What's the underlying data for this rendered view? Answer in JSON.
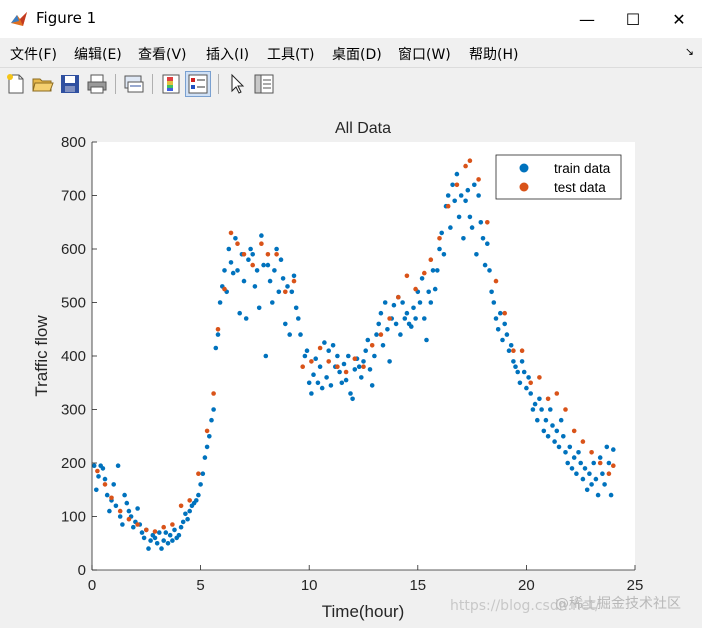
{
  "window": {
    "title": "Figure 1",
    "controls": {
      "minimize": "—",
      "maximize": "☐",
      "close": "✕"
    }
  },
  "menu": {
    "items": [
      "文件(F)",
      "编辑(E)",
      "查看(V)",
      "插入(I)",
      "工具(T)",
      "桌面(D)",
      "窗口(W)",
      "帮助(H)"
    ],
    "overflow_icon": "arrow-corner-icon"
  },
  "toolbar": {
    "buttons": [
      "new-figure-icon",
      "open-file-icon",
      "save-icon",
      "print-icon",
      "link-plot-icon",
      "colorbar-icon",
      "legend-icon",
      "pointer-icon",
      "property-editor-icon"
    ]
  },
  "chart_data": {
    "type": "scatter",
    "title": "All Data",
    "xlabel": "Time(hour)",
    "ylabel": "Traffic flow",
    "xlim": [
      0,
      25
    ],
    "ylim": [
      0,
      800
    ],
    "xticks": [
      0,
      5,
      10,
      15,
      20,
      25
    ],
    "yticks": [
      0,
      100,
      200,
      300,
      400,
      500,
      600,
      700,
      800
    ],
    "grid": false,
    "legend_position": "top-right",
    "series": [
      {
        "name": "train data",
        "color": "#0072BD",
        "points": [
          [
            0.1,
            195
          ],
          [
            0.2,
            150
          ],
          [
            0.3,
            175
          ],
          [
            0.4,
            195
          ],
          [
            0.5,
            190
          ],
          [
            0.6,
            170
          ],
          [
            0.7,
            140
          ],
          [
            0.8,
            110
          ],
          [
            0.9,
            130
          ],
          [
            1.0,
            160
          ],
          [
            1.1,
            120
          ],
          [
            1.2,
            195
          ],
          [
            1.3,
            100
          ],
          [
            1.4,
            85
          ],
          [
            1.5,
            140
          ],
          [
            1.6,
            125
          ],
          [
            1.7,
            110
          ],
          [
            1.8,
            100
          ],
          [
            1.9,
            80
          ],
          [
            2.0,
            90
          ],
          [
            2.1,
            115
          ],
          [
            2.2,
            85
          ],
          [
            2.3,
            70
          ],
          [
            2.4,
            60
          ],
          [
            2.5,
            75
          ],
          [
            2.6,
            40
          ],
          [
            2.7,
            55
          ],
          [
            2.8,
            65
          ],
          [
            2.9,
            60
          ],
          [
            3.0,
            50
          ],
          [
            3.1,
            70
          ],
          [
            3.2,
            40
          ],
          [
            3.3,
            55
          ],
          [
            3.4,
            70
          ],
          [
            3.5,
            50
          ],
          [
            3.6,
            65
          ],
          [
            3.7,
            55
          ],
          [
            3.8,
            75
          ],
          [
            3.9,
            60
          ],
          [
            4.0,
            65
          ],
          [
            4.1,
            80
          ],
          [
            4.2,
            90
          ],
          [
            4.3,
            105
          ],
          [
            4.4,
            95
          ],
          [
            4.5,
            110
          ],
          [
            4.6,
            120
          ],
          [
            4.7,
            125
          ],
          [
            4.8,
            130
          ],
          [
            4.9,
            140
          ],
          [
            5.0,
            160
          ],
          [
            5.1,
            180
          ],
          [
            5.2,
            210
          ],
          [
            5.3,
            230
          ],
          [
            5.4,
            250
          ],
          [
            5.5,
            280
          ],
          [
            5.6,
            300
          ],
          [
            5.7,
            415
          ],
          [
            5.8,
            440
          ],
          [
            5.9,
            500
          ],
          [
            6.0,
            530
          ],
          [
            6.1,
            560
          ],
          [
            6.2,
            520
          ],
          [
            6.3,
            600
          ],
          [
            6.4,
            575
          ],
          [
            6.5,
            555
          ],
          [
            6.6,
            620
          ],
          [
            6.7,
            560
          ],
          [
            6.8,
            480
          ],
          [
            6.9,
            590
          ],
          [
            7.0,
            540
          ],
          [
            7.1,
            470
          ],
          [
            7.2,
            580
          ],
          [
            7.3,
            600
          ],
          [
            7.4,
            590
          ],
          [
            7.5,
            530
          ],
          [
            7.6,
            560
          ],
          [
            7.7,
            490
          ],
          [
            7.8,
            625
          ],
          [
            7.9,
            570
          ],
          [
            8.0,
            400
          ],
          [
            8.1,
            570
          ],
          [
            8.2,
            540
          ],
          [
            8.3,
            500
          ],
          [
            8.4,
            560
          ],
          [
            8.5,
            600
          ],
          [
            8.6,
            520
          ],
          [
            8.7,
            580
          ],
          [
            8.8,
            545
          ],
          [
            8.9,
            460
          ],
          [
            9.0,
            530
          ],
          [
            9.1,
            440
          ],
          [
            9.2,
            520
          ],
          [
            9.3,
            550
          ],
          [
            9.4,
            490
          ],
          [
            9.5,
            470
          ],
          [
            9.6,
            440
          ],
          [
            9.8,
            400
          ],
          [
            9.9,
            410
          ],
          [
            10.0,
            350
          ],
          [
            10.1,
            330
          ],
          [
            10.2,
            365
          ],
          [
            10.3,
            395
          ],
          [
            10.4,
            350
          ],
          [
            10.5,
            380
          ],
          [
            10.6,
            340
          ],
          [
            10.7,
            425
          ],
          [
            10.8,
            360
          ],
          [
            10.9,
            410
          ],
          [
            11.0,
            345
          ],
          [
            11.1,
            420
          ],
          [
            11.2,
            380
          ],
          [
            11.3,
            400
          ],
          [
            11.4,
            370
          ],
          [
            11.5,
            350
          ],
          [
            11.6,
            385
          ],
          [
            11.7,
            355
          ],
          [
            11.8,
            400
          ],
          [
            11.9,
            330
          ],
          [
            12.0,
            320
          ],
          [
            12.1,
            375
          ],
          [
            12.2,
            395
          ],
          [
            12.3,
            380
          ],
          [
            12.4,
            360
          ],
          [
            12.5,
            390
          ],
          [
            12.6,
            410
          ],
          [
            12.7,
            430
          ],
          [
            12.8,
            375
          ],
          [
            12.9,
            345
          ],
          [
            13.0,
            400
          ],
          [
            13.1,
            440
          ],
          [
            13.2,
            460
          ],
          [
            13.3,
            480
          ],
          [
            13.4,
            420
          ],
          [
            13.5,
            500
          ],
          [
            13.6,
            450
          ],
          [
            13.7,
            390
          ],
          [
            13.8,
            470
          ],
          [
            13.9,
            495
          ],
          [
            14.0,
            460
          ],
          [
            14.1,
            510
          ],
          [
            14.2,
            440
          ],
          [
            14.3,
            500
          ],
          [
            14.4,
            470
          ],
          [
            14.5,
            480
          ],
          [
            14.6,
            460
          ],
          [
            14.7,
            455
          ],
          [
            14.8,
            490
          ],
          [
            14.9,
            470
          ],
          [
            15.0,
            520
          ],
          [
            15.1,
            500
          ],
          [
            15.2,
            545
          ],
          [
            15.3,
            470
          ],
          [
            15.4,
            430
          ],
          [
            15.5,
            520
          ],
          [
            15.6,
            500
          ],
          [
            15.7,
            560
          ],
          [
            15.8,
            525
          ],
          [
            15.9,
            560
          ],
          [
            16.0,
            600
          ],
          [
            16.1,
            630
          ],
          [
            16.2,
            590
          ],
          [
            16.3,
            680
          ],
          [
            16.4,
            700
          ],
          [
            16.5,
            640
          ],
          [
            16.6,
            720
          ],
          [
            16.7,
            690
          ],
          [
            16.8,
            740
          ],
          [
            16.9,
            660
          ],
          [
            17.0,
            700
          ],
          [
            17.1,
            620
          ],
          [
            17.2,
            690
          ],
          [
            17.3,
            710
          ],
          [
            17.4,
            660
          ],
          [
            17.5,
            640
          ],
          [
            17.6,
            720
          ],
          [
            17.7,
            590
          ],
          [
            17.8,
            700
          ],
          [
            17.9,
            650
          ],
          [
            18.0,
            620
          ],
          [
            18.1,
            570
          ],
          [
            18.2,
            610
          ],
          [
            18.3,
            560
          ],
          [
            18.4,
            520
          ],
          [
            18.5,
            500
          ],
          [
            18.6,
            470
          ],
          [
            18.7,
            450
          ],
          [
            18.8,
            480
          ],
          [
            18.9,
            430
          ],
          [
            19.0,
            460
          ],
          [
            19.1,
            440
          ],
          [
            19.2,
            410
          ],
          [
            19.3,
            420
          ],
          [
            19.4,
            390
          ],
          [
            19.5,
            380
          ],
          [
            19.6,
            370
          ],
          [
            19.7,
            350
          ],
          [
            19.8,
            390
          ],
          [
            19.9,
            370
          ],
          [
            20.0,
            340
          ],
          [
            20.1,
            360
          ],
          [
            20.2,
            330
          ],
          [
            20.3,
            300
          ],
          [
            20.4,
            310
          ],
          [
            20.5,
            280
          ],
          [
            20.6,
            320
          ],
          [
            20.7,
            300
          ],
          [
            20.8,
            260
          ],
          [
            20.9,
            280
          ],
          [
            21.0,
            250
          ],
          [
            21.1,
            300
          ],
          [
            21.2,
            270
          ],
          [
            21.3,
            240
          ],
          [
            21.4,
            260
          ],
          [
            21.5,
            230
          ],
          [
            21.6,
            280
          ],
          [
            21.7,
            250
          ],
          [
            21.8,
            220
          ],
          [
            21.9,
            200
          ],
          [
            22.0,
            230
          ],
          [
            22.1,
            190
          ],
          [
            22.2,
            210
          ],
          [
            22.3,
            180
          ],
          [
            22.4,
            220
          ],
          [
            22.5,
            200
          ],
          [
            22.6,
            170
          ],
          [
            22.7,
            190
          ],
          [
            22.8,
            150
          ],
          [
            22.9,
            180
          ],
          [
            23.0,
            160
          ],
          [
            23.1,
            200
          ],
          [
            23.2,
            170
          ],
          [
            23.3,
            140
          ],
          [
            23.4,
            210
          ],
          [
            23.5,
            180
          ],
          [
            23.6,
            160
          ],
          [
            23.7,
            230
          ],
          [
            23.8,
            200
          ],
          [
            23.9,
            140
          ],
          [
            24.0,
            225
          ]
        ]
      },
      {
        "name": "test data",
        "color": "#D95319",
        "points": [
          [
            0.25,
            185
          ],
          [
            0.6,
            160
          ],
          [
            0.9,
            135
          ],
          [
            1.3,
            110
          ],
          [
            1.7,
            95
          ],
          [
            2.1,
            85
          ],
          [
            2.5,
            75
          ],
          [
            2.9,
            72
          ],
          [
            3.3,
            80
          ],
          [
            3.7,
            85
          ],
          [
            4.1,
            120
          ],
          [
            4.5,
            130
          ],
          [
            4.9,
            180
          ],
          [
            5.3,
            260
          ],
          [
            5.6,
            330
          ],
          [
            5.8,
            450
          ],
          [
            6.1,
            525
          ],
          [
            6.4,
            630
          ],
          [
            6.7,
            610
          ],
          [
            7.0,
            590
          ],
          [
            7.4,
            570
          ],
          [
            7.8,
            610
          ],
          [
            8.1,
            590
          ],
          [
            8.5,
            590
          ],
          [
            8.9,
            520
          ],
          [
            9.3,
            540
          ],
          [
            9.7,
            380
          ],
          [
            10.1,
            390
          ],
          [
            10.5,
            415
          ],
          [
            10.9,
            390
          ],
          [
            11.3,
            380
          ],
          [
            11.7,
            370
          ],
          [
            12.1,
            395
          ],
          [
            12.5,
            380
          ],
          [
            12.9,
            420
          ],
          [
            13.3,
            440
          ],
          [
            13.7,
            470
          ],
          [
            14.1,
            510
          ],
          [
            14.5,
            550
          ],
          [
            14.9,
            525
          ],
          [
            15.3,
            555
          ],
          [
            15.6,
            580
          ],
          [
            16.0,
            620
          ],
          [
            16.4,
            680
          ],
          [
            16.8,
            720
          ],
          [
            17.2,
            755
          ],
          [
            17.4,
            765
          ],
          [
            17.8,
            730
          ],
          [
            18.2,
            650
          ],
          [
            18.6,
            540
          ],
          [
            19.0,
            480
          ],
          [
            19.4,
            410
          ],
          [
            19.8,
            410
          ],
          [
            20.2,
            350
          ],
          [
            20.6,
            360
          ],
          [
            21.0,
            320
          ],
          [
            21.4,
            330
          ],
          [
            21.8,
            300
          ],
          [
            22.2,
            260
          ],
          [
            22.6,
            240
          ],
          [
            23.0,
            220
          ],
          [
            23.4,
            200
          ],
          [
            23.8,
            180
          ],
          [
            24.0,
            195
          ]
        ]
      }
    ]
  },
  "watermark": {
    "left": "https://blog.csdn.net/",
    "right": "@稀土掘金技术社区"
  }
}
